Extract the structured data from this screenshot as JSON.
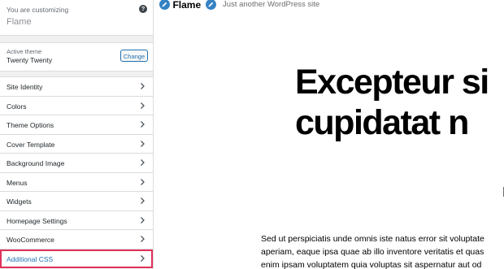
{
  "sidebar": {
    "customizing_label": "You are customizing",
    "site_name": "Flame",
    "help_icon": "?",
    "active_theme_label": "Active theme",
    "active_theme_name": "Twenty Twenty",
    "change_button": "Change",
    "items": [
      {
        "label": "Site Identity",
        "icon": "chevron-right-icon"
      },
      {
        "label": "Colors",
        "icon": "chevron-right-icon"
      },
      {
        "label": "Theme Options",
        "icon": "chevron-right-icon"
      },
      {
        "label": "Cover Template",
        "icon": "chevron-right-icon"
      },
      {
        "label": "Background Image",
        "icon": "chevron-right-icon"
      },
      {
        "label": "Menus",
        "icon": "chevron-right-icon"
      },
      {
        "label": "Widgets",
        "icon": "chevron-right-icon"
      },
      {
        "label": "Homepage Settings",
        "icon": "chevron-right-icon"
      },
      {
        "label": "WooCommerce",
        "icon": "chevron-right-icon"
      },
      {
        "label": "Additional CSS",
        "icon": "chevron-right-icon",
        "highlighted": true
      }
    ]
  },
  "preview": {
    "site_title": "Flame",
    "tagline": "Just another WordPress site",
    "headline_line1": "Excepteur si",
    "headline_line2": "cupidatat n",
    "body_lines": [
      "Sed ut perspiciatis unde omnis iste natus error sit voluptate",
      "aperiam, eaque ipsa quae ab illo inventore veritatis et quas",
      "enim ipsam voluptatem quia voluptas sit aspernatur aut od"
    ]
  },
  "colors": {
    "accent": "#2271b1",
    "highlight_border": "#e0315a",
    "edit_icon": "#3582c4"
  }
}
